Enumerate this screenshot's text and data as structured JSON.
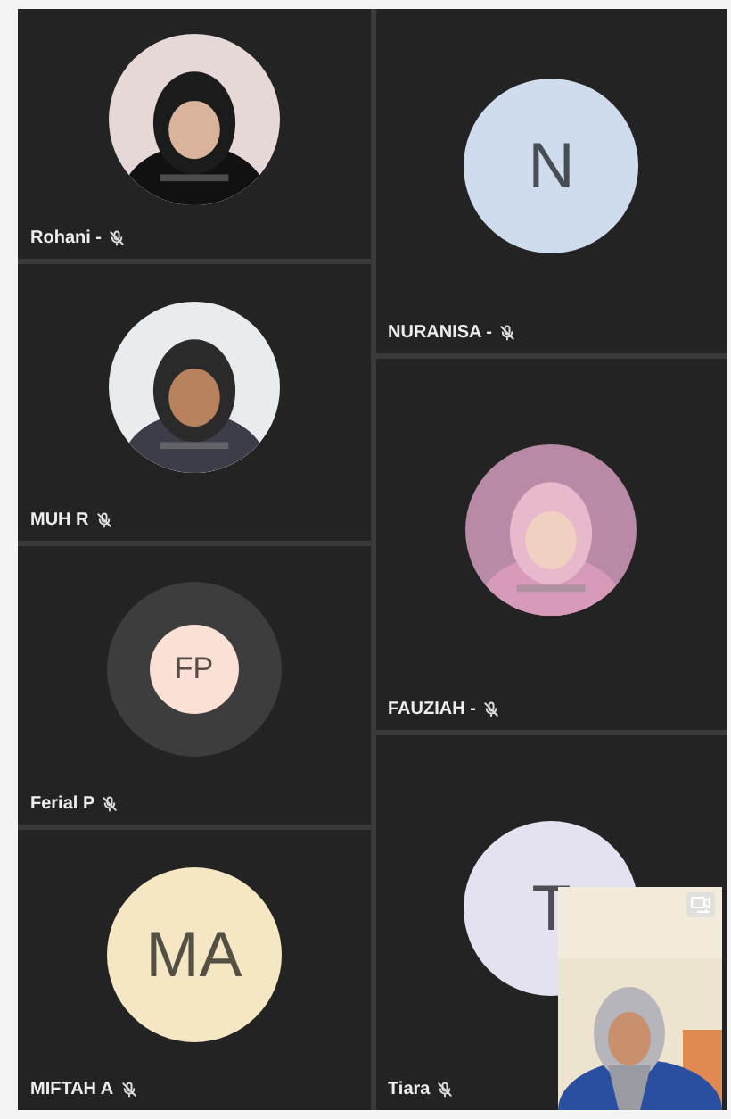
{
  "columns": [
    {
      "tiles": [
        {
          "name": "Rohani -",
          "muted": true,
          "speaking": false
        },
        {
          "name": "MUH R",
          "muted": true,
          "speaking": false
        },
        {
          "kind": "initials",
          "initials": "FP",
          "color": "#fbe0d6",
          "name": "Ferial P",
          "muted": true,
          "speaking": true
        },
        {
          "kind": "initials",
          "initials": "MA",
          "color": "#f5e6c4",
          "name": "MIFTAH A",
          "muted": true,
          "speaking": false
        }
      ]
    },
    {
      "tiles": [
        {
          "kind": "initials",
          "initials": "N",
          "color": "#cfdcee",
          "name": "NURANISA -",
          "muted": true,
          "speaking": false
        },
        {
          "name": "FAUZIAH -",
          "muted": true,
          "speaking": false
        },
        {
          "kind": "initials",
          "initials": "T",
          "color": "#e4e1f1",
          "name": "Tiara",
          "muted": true,
          "speaking": false
        }
      ]
    }
  ]
}
